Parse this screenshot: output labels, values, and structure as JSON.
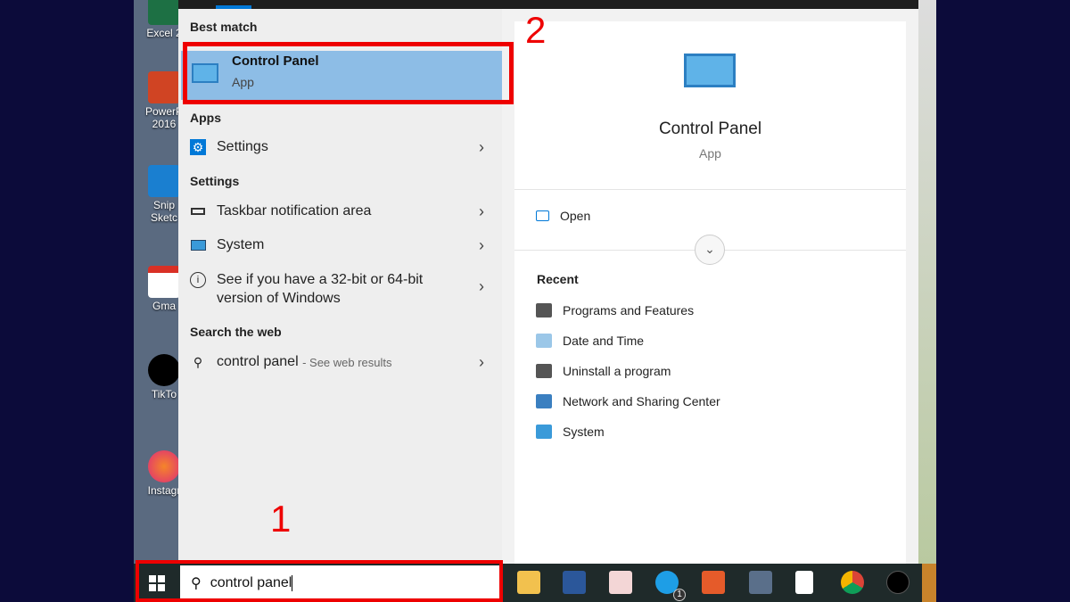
{
  "desktop": {
    "icons": [
      {
        "label": "Excel 2"
      },
      {
        "label": "PowerP\n2016"
      },
      {
        "label": "Snip\nSketc"
      },
      {
        "label": "Gma"
      },
      {
        "label": "TikTo"
      },
      {
        "label": "Instagr"
      }
    ]
  },
  "annotations": {
    "step1": "1",
    "step2": "2"
  },
  "left": {
    "best_match_header": "Best match",
    "best": {
      "title": "Control Panel",
      "subtitle": "App"
    },
    "apps_header": "Apps",
    "apps": [
      {
        "label": "Settings"
      }
    ],
    "settings_header": "Settings",
    "settings": [
      {
        "label": "Taskbar notification area"
      },
      {
        "label": "System"
      },
      {
        "label": "See if you have a 32-bit or 64-bit version of Windows"
      }
    ],
    "web_header": "Search the web",
    "web": {
      "query": "control panel",
      "suffix": "- See web results"
    }
  },
  "right": {
    "title": "Control Panel",
    "subtitle": "App",
    "open_label": "Open",
    "recent_header": "Recent",
    "recent": [
      {
        "label": "Programs and Features"
      },
      {
        "label": "Date and Time"
      },
      {
        "label": "Uninstall a program"
      },
      {
        "label": "Network and Sharing Center"
      },
      {
        "label": "System"
      }
    ]
  },
  "taskbar": {
    "search_value": "control panel",
    "skype_badge": "1",
    "apps": [
      "file-explorer",
      "word",
      "app",
      "skype",
      "snip-sketch",
      "calculator",
      "notepad",
      "chrome",
      "tiktok"
    ]
  },
  "colors": {
    "highlight": "#8dbde6",
    "annotation": "#e00000",
    "accent": "#0078d7"
  }
}
